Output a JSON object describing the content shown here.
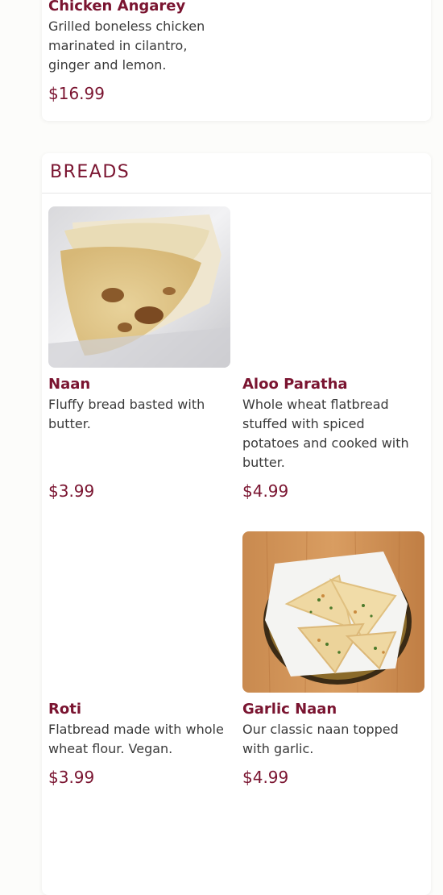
{
  "top_item": {
    "name": "Chicken Angarey",
    "description": "Grilled boneless chicken marinated in cilantro, ginger and lemon.",
    "price": "$16.99"
  },
  "section": {
    "title": "BREADS",
    "items": [
      {
        "name": "Naan",
        "description": "Fluffy bread basted with butter.",
        "price": "$3.99",
        "image": "naan-photo"
      },
      {
        "name": "Aloo Paratha",
        "description": "Whole wheat flatbread stuffed with spiced potatoes and cooked with butter.",
        "price": "$4.99",
        "image": ""
      },
      {
        "name": "Roti",
        "description": "Flatbread made with whole wheat flour. Vegan.",
        "price": "$3.99",
        "image": ""
      },
      {
        "name": "Garlic Naan",
        "description": "Our classic naan topped with garlic.",
        "price": "$4.99",
        "image": "garlic-naan-photo"
      }
    ]
  },
  "colors": {
    "accent": "#7a1430",
    "text": "#3a3a3a",
    "background": "#fcfcfa",
    "card": "#ffffff"
  }
}
